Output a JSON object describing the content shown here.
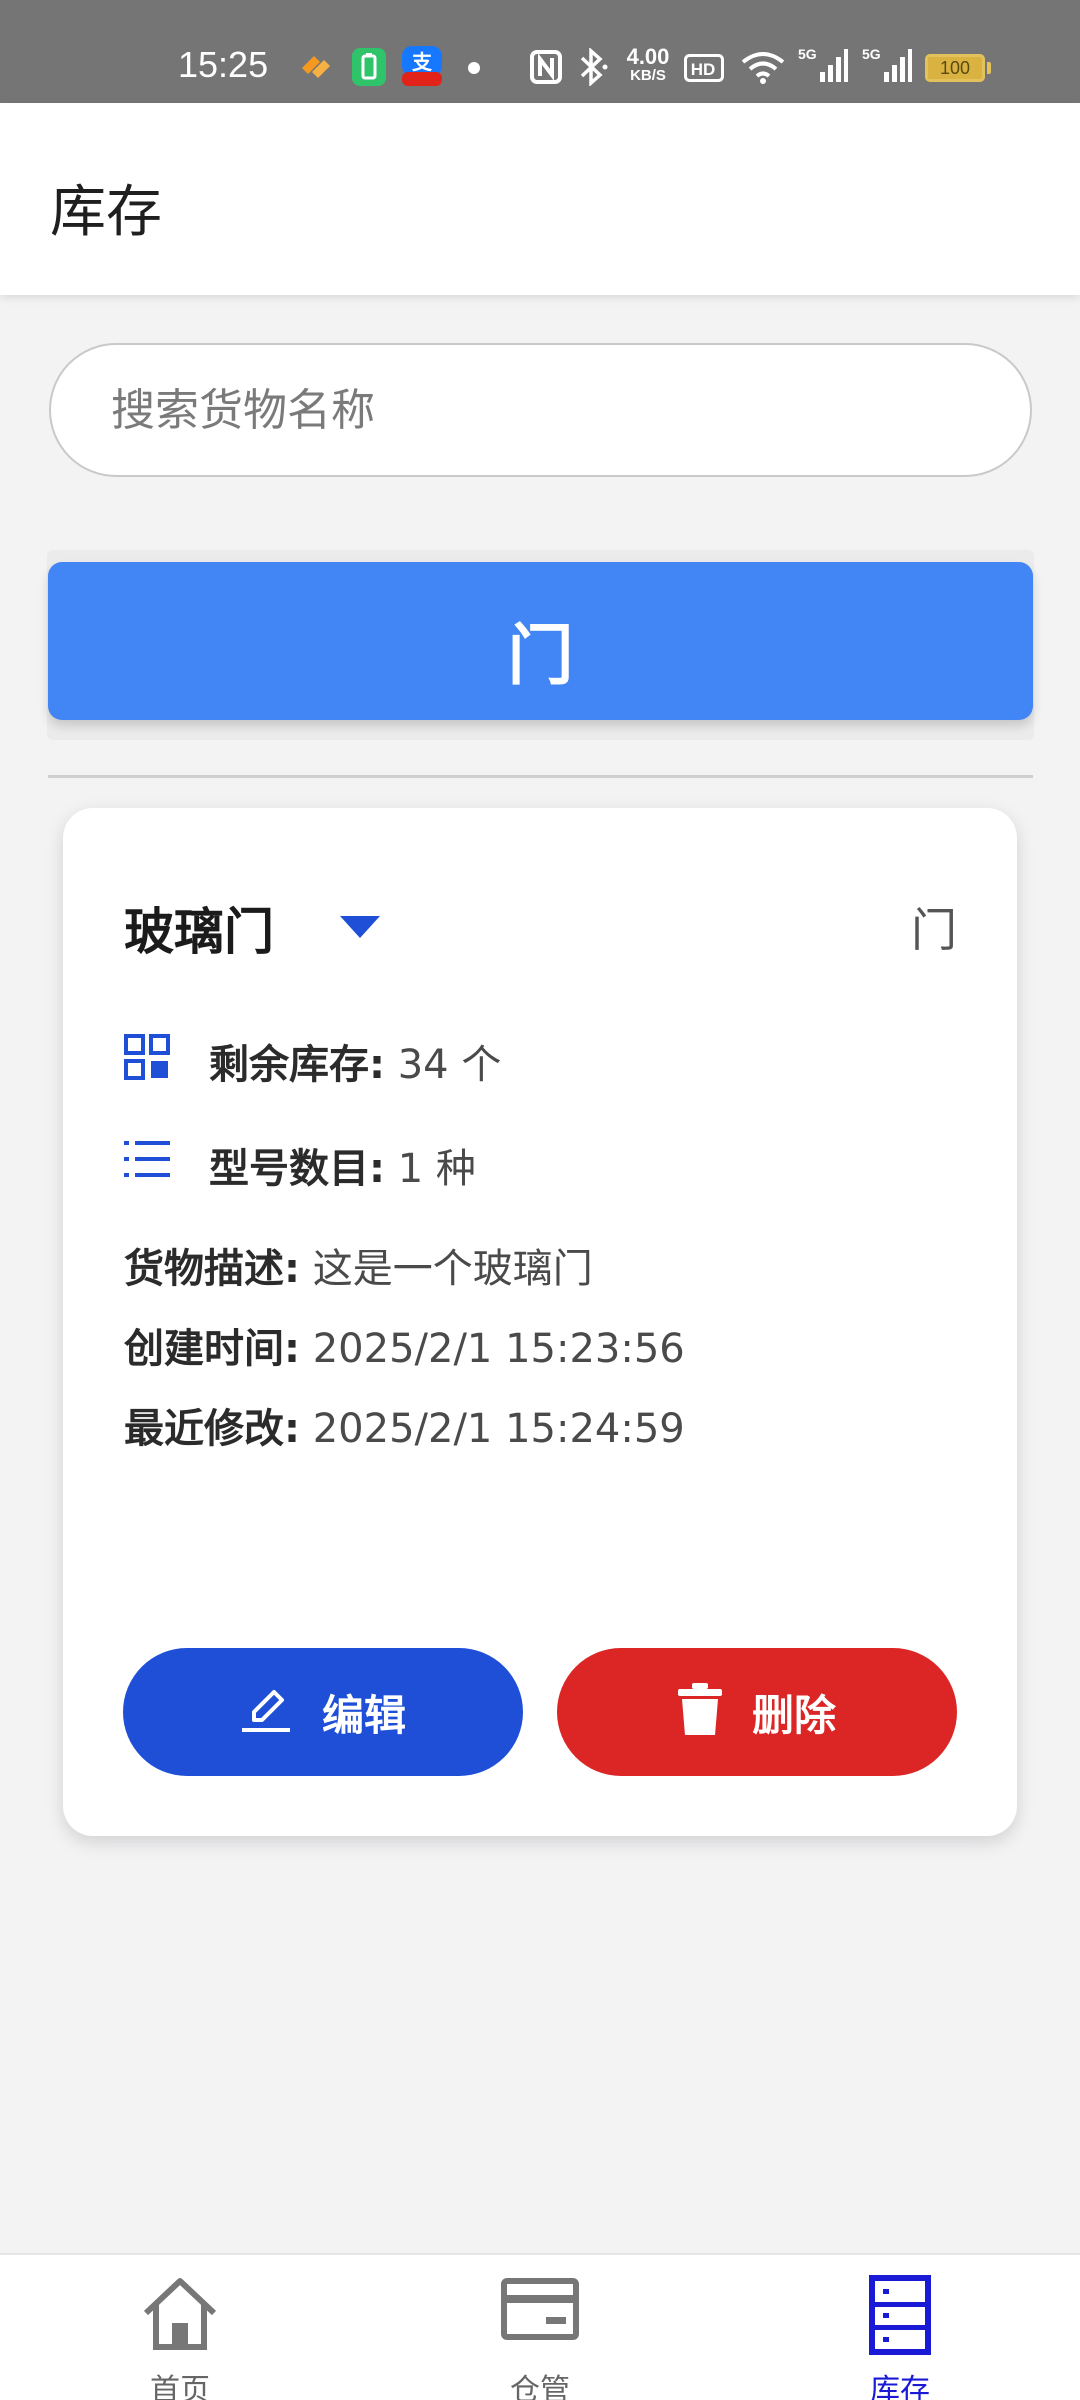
{
  "status_bar": {
    "time": "15:25",
    "net_speed_value": "4.00",
    "net_speed_unit": "KB/S",
    "battery_level": "100"
  },
  "app_bar": {
    "title": "库存"
  },
  "search": {
    "placeholder": "搜索货物名称",
    "value": ""
  },
  "category": {
    "label": "门"
  },
  "item": {
    "name": "玻璃门",
    "tag": "门",
    "stock_label": "剩余库存:",
    "stock_value": " 34 个",
    "models_label": "型号数目:",
    "models_value": " 1 种",
    "desc_label": "货物描述:",
    "desc_value": " 这是一个玻璃门",
    "created_label": "创建时间:",
    "created_value": " 2025/2/1 15:23:56",
    "modified_label": "最近修改:",
    "modified_value": " 2025/2/1 15:24:59",
    "edit_label": "编辑",
    "delete_label": "删除"
  },
  "bottom_nav": {
    "items": [
      {
        "label": "首页",
        "icon": "home-icon",
        "active": false
      },
      {
        "label": "仓管",
        "icon": "wallet-icon",
        "active": false
      },
      {
        "label": "库存",
        "icon": "inventory-icon",
        "active": true
      }
    ]
  },
  "colors": {
    "primary_blue": "#4285f4",
    "edit_blue": "#1e4fd6",
    "delete_red": "#dc2626",
    "nav_active": "#1a1ad6"
  }
}
